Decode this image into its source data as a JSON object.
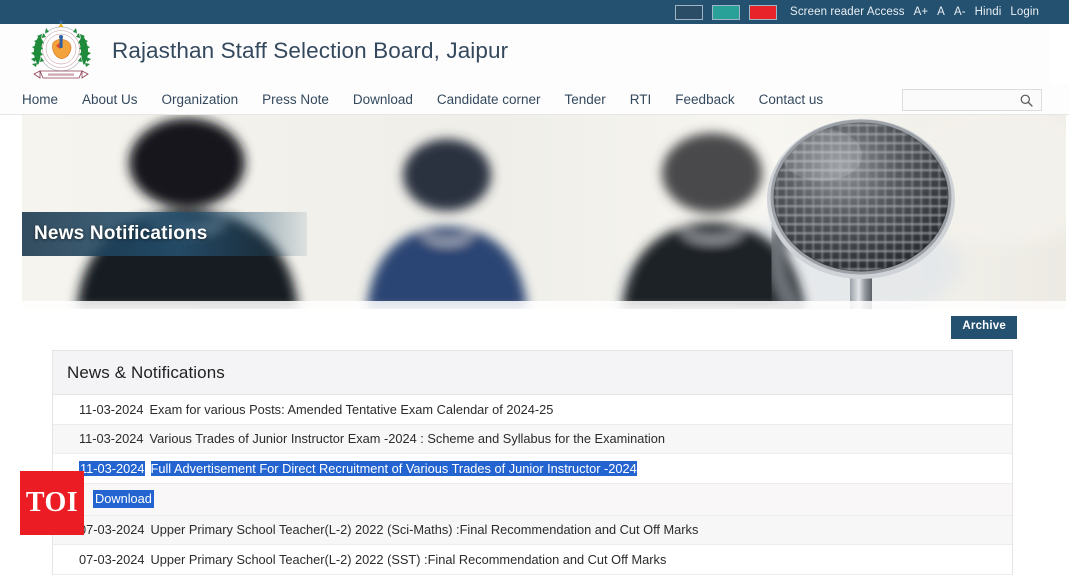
{
  "topbar": {
    "swatches": [
      {
        "name": "theme-dark",
        "color": "#2c4d66"
      },
      {
        "name": "theme-teal",
        "color": "#2aa198"
      },
      {
        "name": "theme-red",
        "color": "#e8232a"
      }
    ],
    "screen_reader": "Screen reader Access",
    "font_increase": "A+",
    "font_normal": "A",
    "font_decrease": "A-",
    "language": "Hindi",
    "login": "Login"
  },
  "masthead": {
    "title": "Rajasthan Staff Selection Board, Jaipur",
    "emblem_alt": "rajasthan-government-emblem"
  },
  "nav": {
    "items": [
      {
        "label": "Home"
      },
      {
        "label": "About Us"
      },
      {
        "label": "Organization"
      },
      {
        "label": "Press Note"
      },
      {
        "label": "Download"
      },
      {
        "label": "Candidate corner"
      },
      {
        "label": "Tender"
      },
      {
        "label": "RTI"
      },
      {
        "label": "Feedback"
      },
      {
        "label": "Contact us"
      }
    ]
  },
  "search": {
    "value": "",
    "placeholder": "",
    "icon": "search-icon"
  },
  "hero": {
    "caption": "News Notifications",
    "image_alt": "blurred-people-and-microphone-banner"
  },
  "archive": {
    "label": "Archive"
  },
  "panel": {
    "heading": "News & Notifications",
    "rows": [
      {
        "date": "11-03-2024",
        "title": "Exam for various Posts: Amended Tentative Exam Calendar of 2024-25",
        "selected": false
      },
      {
        "date": "11-03-2024",
        "title": "Various Trades of Junior Instructor Exam -2024 : Scheme and Syllabus for the Examination",
        "selected": false
      },
      {
        "date": "11-03-2024",
        "title": "Full Advertisement For Direct Recruitment of Various Trades of Junior Instructor -2024",
        "selected": true
      }
    ],
    "download_label": "Download",
    "rows_after": [
      {
        "date": "07-03-2024",
        "title": "Upper Primary School Teacher(L-2) 2022 (Sci-Maths) :Final Recommendation and Cut Off Marks",
        "selected": false
      },
      {
        "date": "07-03-2024",
        "title": "Upper Primary School Teacher(L-2) 2022 (SST) :Final Recommendation and Cut Off Marks",
        "selected": false
      }
    ]
  },
  "watermark": {
    "label": "TOI",
    "color": "#ec1c24"
  }
}
